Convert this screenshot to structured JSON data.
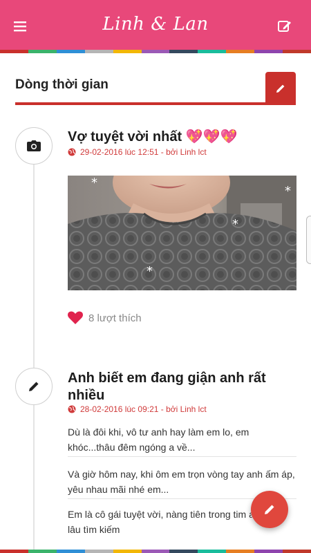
{
  "appbar": {
    "title": "Linh & Lan",
    "menu_icon": "menu-icon",
    "compose_icon": "compose-icon",
    "color": "#e8487a"
  },
  "stripe_colors": [
    "#c9302c",
    "#3bb36b",
    "#2f8fd6",
    "#b5b5b5",
    "#f2b705",
    "#9b59b6",
    "#34495e",
    "#1abc9c",
    "#e67e22",
    "#8e44ad",
    "#c0392b"
  ],
  "section": {
    "heading": "Dòng thời gian",
    "tab_icon": "pencil-icon",
    "accent": "#c9302c"
  },
  "posts": [
    {
      "icon": "camera-icon",
      "title": "Vợ tuyệt vời nhất 💖💖💖",
      "meta": "29-02-2016 lúc 12:51 - bởi Linh lct",
      "likes": "8 lượt thích"
    },
    {
      "icon": "pencil-icon",
      "title": "Anh biết em đang giận anh rất nhiều",
      "meta": "28-02-2016 lúc 09:21 - bởi Linh lct",
      "paragraphs": [
        "Dù là đôi khi, vô tư anh hay làm em lo, em khóc...thâu đêm ngóng a về...",
        "Và giờ hôm nay, khi ôm em trọn vòng tay anh ấm áp, yêu nhau mãi nhé em...",
        "Em là cô gái tuyệt vời, nàng tiên trong tim anh bao lâu tìm kiếm"
      ]
    }
  ],
  "fab_icon": "pencil-icon",
  "accent_red": "#e0473d"
}
